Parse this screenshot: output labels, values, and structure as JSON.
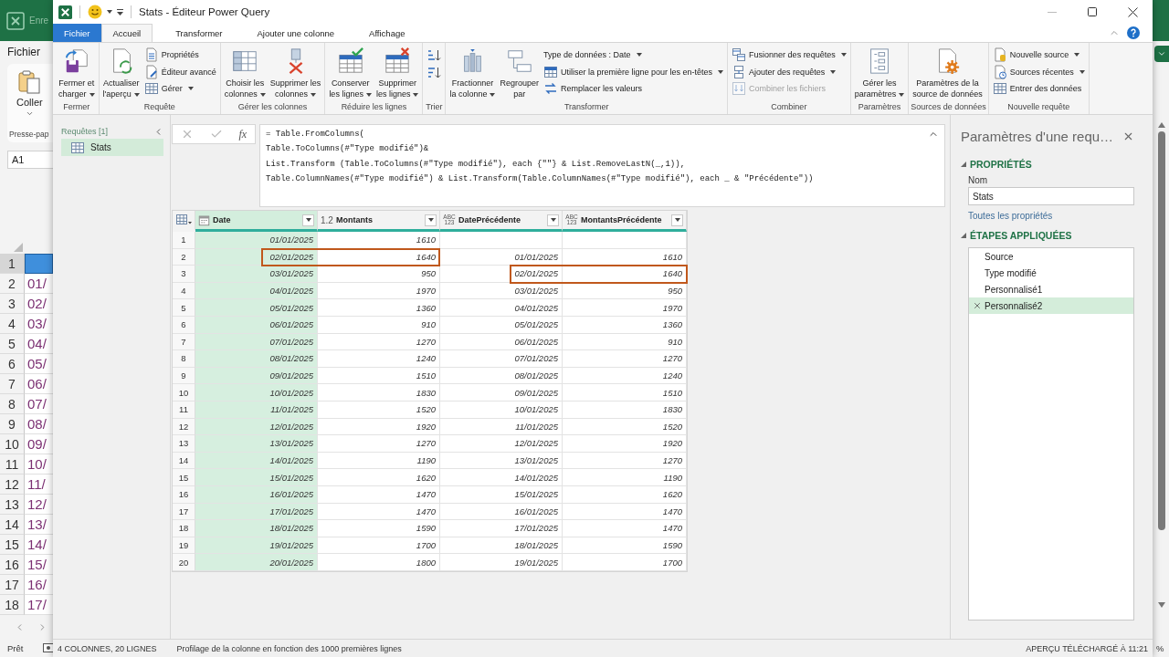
{
  "excel_background": {
    "autosave_label": "Enre",
    "ribbon_tab": "Fichier",
    "paste_button": "Coller",
    "clipboard_group": "Presse-pap",
    "name_box": "A1",
    "rows": [
      {
        "number": "1",
        "kind": "header"
      },
      {
        "number": "2",
        "kind": "data",
        "value": "01/"
      },
      {
        "number": "3",
        "kind": "data",
        "value": "02/"
      },
      {
        "number": "4",
        "kind": "data",
        "value": "03/"
      },
      {
        "number": "5",
        "kind": "data",
        "value": "04/"
      },
      {
        "number": "6",
        "kind": "data",
        "value": "05/"
      },
      {
        "number": "7",
        "kind": "data",
        "value": "06/"
      },
      {
        "number": "8",
        "kind": "data",
        "value": "07/"
      },
      {
        "number": "9",
        "kind": "data",
        "value": "08/"
      },
      {
        "number": "10",
        "kind": "data",
        "value": "09/"
      },
      {
        "number": "11",
        "kind": "data",
        "value": "10/"
      },
      {
        "number": "12",
        "kind": "data",
        "value": "11/"
      },
      {
        "number": "13",
        "kind": "data",
        "value": "12/"
      },
      {
        "number": "14",
        "kind": "data",
        "value": "13/"
      },
      {
        "number": "15",
        "kind": "data",
        "value": "14/"
      },
      {
        "number": "16",
        "kind": "data",
        "value": "15/"
      },
      {
        "number": "17",
        "kind": "data",
        "value": "16/"
      },
      {
        "number": "18",
        "kind": "data",
        "value": "17/"
      }
    ],
    "status": "Prêt",
    "zoom_fragment": "%"
  },
  "window": {
    "title": "Stats - Éditeur Power Query"
  },
  "tabs": [
    {
      "label": "Fichier",
      "kind": "file",
      "selected": false
    },
    {
      "label": "Accueil",
      "kind": "tab",
      "selected": true
    },
    {
      "label": "Transformer",
      "kind": "tab",
      "selected": false
    },
    {
      "label": "Ajouter une colonne",
      "kind": "tab",
      "selected": false
    },
    {
      "label": "Affichage",
      "kind": "tab",
      "selected": false
    }
  ],
  "ribbon": [
    {
      "label": "Fermer",
      "items": [
        {
          "kind": "large",
          "label": "Fermer et\ncharger",
          "dropdown": true,
          "disabled": false
        }
      ]
    },
    {
      "label": "Requête",
      "items": [
        {
          "kind": "large",
          "label": "Actualiser\nl'aperçu",
          "dropdown": true,
          "disabled": false
        },
        {
          "kind": "small",
          "label": "Propriétés",
          "dropdown": false,
          "disabled": false
        },
        {
          "kind": "small",
          "label": "Éditeur avancé",
          "dropdown": false,
          "disabled": false
        },
        {
          "kind": "small",
          "label": "Gérer",
          "dropdown": true,
          "disabled": false
        }
      ]
    },
    {
      "label": "Gérer les colonnes",
      "items": [
        {
          "kind": "large",
          "label": "Choisir les\ncolonnes",
          "dropdown": true,
          "disabled": false
        },
        {
          "kind": "large",
          "label": "Supprimer les\ncolonnes",
          "dropdown": true,
          "disabled": false
        }
      ]
    },
    {
      "label": "Réduire les lignes",
      "items": [
        {
          "kind": "large",
          "label": "Conserver\nles lignes",
          "dropdown": true,
          "disabled": false
        },
        {
          "kind": "large",
          "label": "Supprimer\nles lignes",
          "dropdown": true,
          "disabled": false
        }
      ]
    },
    {
      "label": "Trier",
      "items": [
        {
          "kind": "icon",
          "dropdown": false,
          "disabled": false
        },
        {
          "kind": "icon",
          "dropdown": false,
          "disabled": false
        }
      ]
    },
    {
      "label": "Transformer",
      "items": [
        {
          "kind": "large",
          "label": "Fractionner\nla colonne",
          "dropdown": true,
          "disabled": false
        },
        {
          "kind": "large",
          "label": "Regrouper\npar",
          "dropdown": false,
          "disabled": false
        },
        {
          "kind": "small",
          "label": "Type de données : Date",
          "dropdown": true,
          "disabled": false
        },
        {
          "kind": "small",
          "label": "Utiliser la première ligne pour les en-têtes",
          "dropdown": true,
          "disabled": false
        },
        {
          "kind": "small",
          "label": "Remplacer les valeurs",
          "dropdown": false,
          "disabled": false
        }
      ]
    },
    {
      "label": "Combiner",
      "items": [
        {
          "kind": "small",
          "label": "Fusionner des requêtes",
          "dropdown": true,
          "disabled": false
        },
        {
          "kind": "small",
          "label": "Ajouter des requêtes",
          "dropdown": true,
          "disabled": false
        },
        {
          "kind": "small",
          "label": "Combiner les fichiers",
          "dropdown": false,
          "disabled": true
        }
      ]
    },
    {
      "label": "Paramètres",
      "items": [
        {
          "kind": "large",
          "label": "Gérer les\nparamètres",
          "dropdown": true,
          "disabled": false
        }
      ]
    },
    {
      "label": "Sources de données",
      "items": [
        {
          "kind": "large",
          "label": "Paramètres de la\nsource de données",
          "dropdown": false,
          "disabled": false
        }
      ]
    },
    {
      "label": "Nouvelle requête",
      "items": [
        {
          "kind": "small",
          "label": "Nouvelle source",
          "dropdown": true,
          "disabled": false
        },
        {
          "kind": "small",
          "label": "Sources récentes",
          "dropdown": true,
          "disabled": false
        },
        {
          "kind": "small",
          "label": "Entrer des données",
          "dropdown": false,
          "disabled": false
        }
      ]
    }
  ],
  "queries_pane": {
    "heading": "Requêtes [1]",
    "queries": [
      {
        "name": "Stats",
        "selected": true
      }
    ]
  },
  "formula_bar": {
    "function_label": "fx",
    "formula": "= Table.FromColumns(\nTable.ToColumns(#\"Type modifié\")&\nList.Transform (Table.ToColumns(#\"Type modifié\"), each {\"\"} & List.RemoveLastN(_,1)),\nTable.ColumnNames(#\"Type modifié\") & List.Transform(Table.ColumnNames(#\"Type modifié\"), each _ & \"Précédente\"))"
  },
  "table": {
    "columns": [
      {
        "name": "Date",
        "kind": "date",
        "selected": true
      },
      {
        "name": "Montants",
        "kind": "number",
        "type_label": "1.2",
        "selected": false
      },
      {
        "name": "DatePrécédente",
        "kind": "any",
        "type_label": "ABC\n123",
        "selected": false
      },
      {
        "name": "MontantsPrécédente",
        "kind": "any",
        "type_label": "ABC\n123",
        "selected": false
      }
    ],
    "rows": [
      {
        "number": "1",
        "kind": "plain",
        "cells": [
          "01/01/2025",
          "1610"
        ]
      },
      {
        "number": "2",
        "kind": "outline-left",
        "cells": [
          "02/01/2025",
          "1640",
          "01/01/2025",
          "1610"
        ]
      },
      {
        "number": "3",
        "kind": "outline-right",
        "cells": [
          "03/01/2025",
          "950",
          "02/01/2025",
          "1640"
        ]
      },
      {
        "number": "4",
        "kind": "plain",
        "cells": [
          "04/01/2025",
          "1970",
          "03/01/2025",
          "950"
        ]
      },
      {
        "number": "5",
        "kind": "plain",
        "cells": [
          "05/01/2025",
          "1360",
          "04/01/2025",
          "1970"
        ]
      },
      {
        "number": "6",
        "kind": "plain",
        "cells": [
          "06/01/2025",
          "910",
          "05/01/2025",
          "1360"
        ]
      },
      {
        "number": "7",
        "kind": "plain",
        "cells": [
          "07/01/2025",
          "1270",
          "06/01/2025",
          "910"
        ]
      },
      {
        "number": "8",
        "kind": "plain",
        "cells": [
          "08/01/2025",
          "1240",
          "07/01/2025",
          "1270"
        ]
      },
      {
        "number": "9",
        "kind": "plain",
        "cells": [
          "09/01/2025",
          "1510",
          "08/01/2025",
          "1240"
        ]
      },
      {
        "number": "10",
        "kind": "plain",
        "cells": [
          "10/01/2025",
          "1830",
          "09/01/2025",
          "1510"
        ]
      },
      {
        "number": "11",
        "kind": "plain",
        "cells": [
          "11/01/2025",
          "1520",
          "10/01/2025",
          "1830"
        ]
      },
      {
        "number": "12",
        "kind": "plain",
        "cells": [
          "12/01/2025",
          "1920",
          "11/01/2025",
          "1520"
        ]
      },
      {
        "number": "13",
        "kind": "plain",
        "cells": [
          "13/01/2025",
          "1270",
          "12/01/2025",
          "1920"
        ]
      },
      {
        "number": "14",
        "kind": "plain",
        "cells": [
          "14/01/2025",
          "1190",
          "13/01/2025",
          "1270"
        ]
      },
      {
        "number": "15",
        "kind": "plain",
        "cells": [
          "15/01/2025",
          "1620",
          "14/01/2025",
          "1190"
        ]
      },
      {
        "number": "16",
        "kind": "plain",
        "cells": [
          "16/01/2025",
          "1470",
          "15/01/2025",
          "1620"
        ]
      },
      {
        "number": "17",
        "kind": "plain",
        "cells": [
          "17/01/2025",
          "1470",
          "16/01/2025",
          "1470"
        ]
      },
      {
        "number": "18",
        "kind": "plain",
        "cells": [
          "18/01/2025",
          "1590",
          "17/01/2025",
          "1470"
        ]
      },
      {
        "number": "19",
        "kind": "plain",
        "cells": [
          "19/01/2025",
          "1700",
          "18/01/2025",
          "1590"
        ]
      },
      {
        "number": "20",
        "kind": "plain",
        "cells": [
          "20/01/2025",
          "1800",
          "19/01/2025",
          "1700"
        ]
      }
    ]
  },
  "query_settings": {
    "title": "Paramètres d'une requ…",
    "properties": {
      "heading": "PROPRIÉTÉS",
      "expanded": true,
      "name_label": "Nom",
      "name_value": "Stats",
      "all_properties_link": "Toutes les propriétés"
    },
    "applied_steps": {
      "heading": "ÉTAPES APPLIQUÉES",
      "expanded": true,
      "steps": [
        {
          "label": "Source",
          "selected": false
        },
        {
          "label": "Type modifié",
          "selected": false
        },
        {
          "label": "Personnalisé1",
          "selected": false
        },
        {
          "label": "Personnalisé2",
          "selected": true
        }
      ]
    }
  },
  "status_bar": {
    "column_count": "4 COLONNES, 20 LIGNES",
    "profiling": "Profilage de la colonne en fonction des 1000 premières lignes",
    "preview_time": "APERÇU TÉLÉCHARGÉ À 11:21"
  }
}
